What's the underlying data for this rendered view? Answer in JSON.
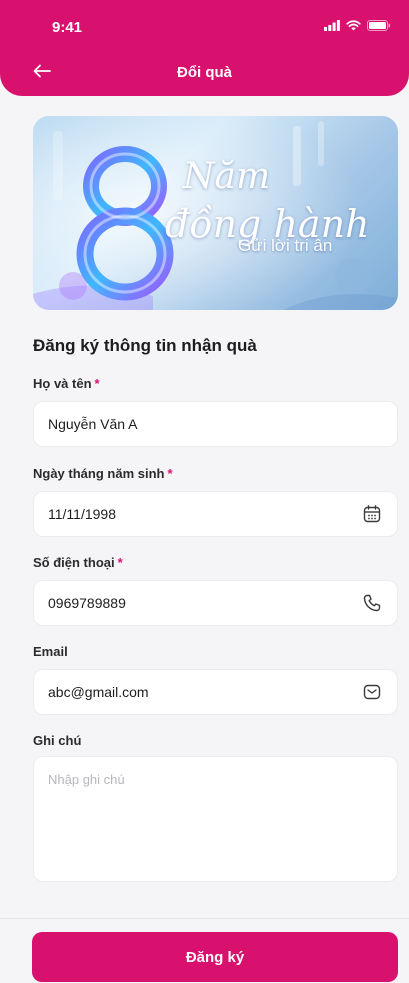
{
  "status_bar": {
    "time": "9:41",
    "icons": [
      "signal-icon",
      "wifi-icon",
      "battery-icon"
    ]
  },
  "header": {
    "title": "Đổi quà",
    "back_icon": "arrow-left-icon"
  },
  "banner": {
    "number": "8",
    "line1": "Năm",
    "line2": "đồng hành",
    "line3": "Gửi lời tri ân"
  },
  "form": {
    "title": "Đăng ký thông tin nhận quà",
    "required_mark": "*",
    "fields": {
      "name": {
        "label": "Họ và tên",
        "value": "Nguyễn Văn A"
      },
      "dob": {
        "label": "Ngày tháng năm sinh",
        "value": "11/11/1998",
        "icon": "calendar-icon"
      },
      "phone": {
        "label": "Số điện thoại",
        "value": "0969789889",
        "icon": "phone-icon"
      },
      "email": {
        "label": "Email",
        "value": "abc@gmail.com",
        "icon": "mail-icon"
      },
      "note": {
        "label": "Ghi chú",
        "placeholder": "Nhập ghi chú"
      }
    }
  },
  "footer": {
    "submit_label": "Đăng ký"
  },
  "colors": {
    "primary": "#d8116f",
    "background": "#f5f5f7"
  }
}
